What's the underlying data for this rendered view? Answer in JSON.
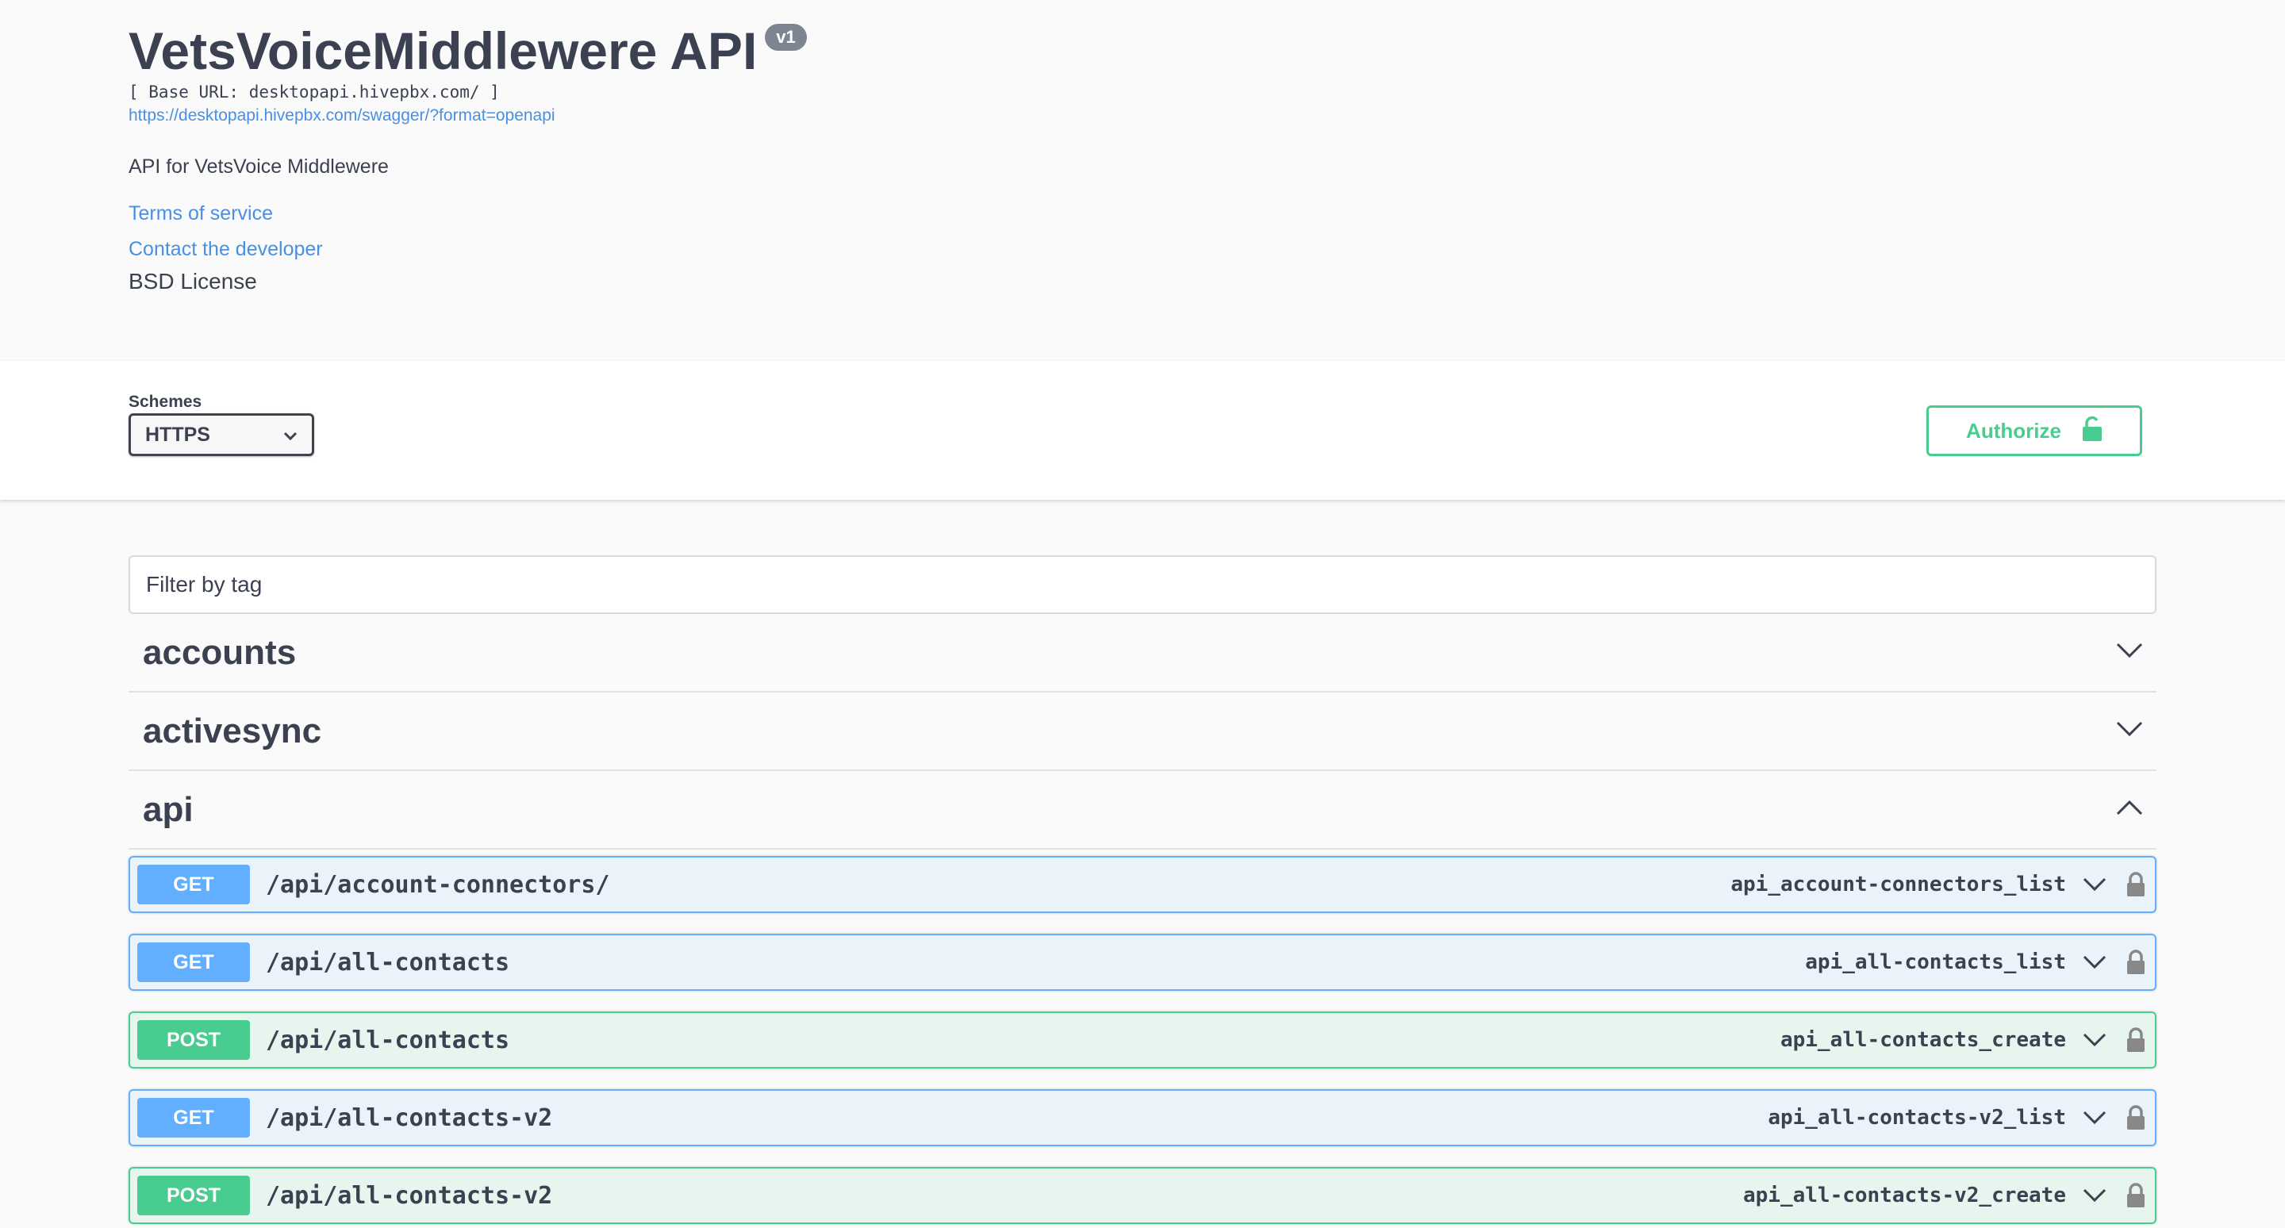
{
  "info": {
    "title": "VetsVoiceMiddlewere API",
    "version": "v1",
    "base_url": "[ Base URL: desktopapi.hivepbx.com/ ]",
    "spec_url": "https://desktopapi.hivepbx.com/swagger/?format=openapi",
    "description": "API for VetsVoice Middlewere",
    "terms_label": "Terms of service",
    "contact_label": "Contact the developer",
    "license": "BSD License"
  },
  "schemes": {
    "label": "Schemes",
    "selected": "HTTPS"
  },
  "authorize": {
    "label": "Authorize"
  },
  "filter": {
    "placeholder": "Filter by tag"
  },
  "tags": [
    {
      "name": "accounts",
      "expanded": false
    },
    {
      "name": "activesync",
      "expanded": false
    },
    {
      "name": "api",
      "expanded": true
    }
  ],
  "operations": [
    {
      "method": "GET",
      "path": "/api/account-connectors/",
      "operation_id": "api_account-connectors_list"
    },
    {
      "method": "GET",
      "path": "/api/all-contacts",
      "operation_id": "api_all-contacts_list"
    },
    {
      "method": "POST",
      "path": "/api/all-contacts",
      "operation_id": "api_all-contacts_create"
    },
    {
      "method": "GET",
      "path": "/api/all-contacts-v2",
      "operation_id": "api_all-contacts-v2_list"
    },
    {
      "method": "POST",
      "path": "/api/all-contacts-v2",
      "operation_id": "api_all-contacts-v2_create"
    }
  ],
  "colors": {
    "get": "#61affe",
    "post": "#49cc90",
    "link": "#4990e2",
    "text": "#3b4151"
  },
  "icons": {
    "tag_collapsed": "chevron-down-icon",
    "tag_expanded": "chevron-up-icon",
    "operation_toggle": "chevron-down-icon",
    "operation_auth": "lock-icon",
    "authorize": "unlocked-icon"
  }
}
